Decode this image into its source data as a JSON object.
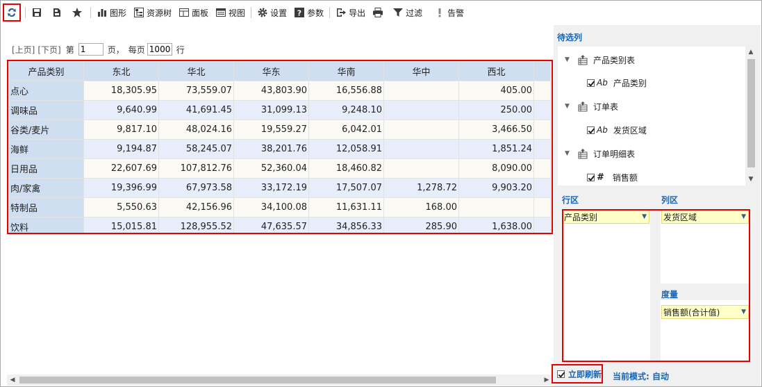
{
  "toolbar": {
    "refresh_title": "刷新",
    "items": [
      {
        "id": "save",
        "icon": "save-icon",
        "label": ""
      },
      {
        "id": "saveas",
        "icon": "save-as-icon",
        "label": ""
      },
      {
        "id": "favorite",
        "icon": "star-icon",
        "label": ""
      },
      {
        "id": "chart",
        "icon": "bar-chart-icon",
        "label": "图形"
      },
      {
        "id": "resource",
        "icon": "resource-tree-icon",
        "label": "资源树"
      },
      {
        "id": "panel",
        "icon": "panel-icon",
        "label": "面板"
      },
      {
        "id": "view",
        "icon": "view-icon",
        "label": "视图"
      },
      {
        "id": "settings",
        "icon": "gear-icon",
        "label": "设置"
      },
      {
        "id": "params",
        "icon": "question-icon",
        "label": "参数"
      },
      {
        "id": "export",
        "icon": "export-icon",
        "label": "导出"
      },
      {
        "id": "print",
        "icon": "printer-icon",
        "label": ""
      },
      {
        "id": "filter",
        "icon": "filter-icon",
        "label": "过滤"
      },
      {
        "id": "alert",
        "icon": "alert-icon",
        "label": "告警"
      }
    ]
  },
  "pager": {
    "prev": "[上页]",
    "next": "[下页]",
    "page_prefix": "第",
    "page_value": "1",
    "page_suffix": "页，",
    "per_page_prefix": "每页",
    "per_page_value": "1000",
    "per_page_suffix": "行"
  },
  "grid": {
    "row_header": "产品类别",
    "columns": [
      "东北",
      "华北",
      "华东",
      "华南",
      "华中",
      "西北"
    ],
    "rows": [
      {
        "label": "点心",
        "values": [
          "18,305.95",
          "73,559.07",
          "43,803.90",
          "16,556.88",
          "",
          "405.00"
        ]
      },
      {
        "label": "调味品",
        "values": [
          "9,640.99",
          "41,691.45",
          "31,099.13",
          "9,248.10",
          "",
          "250.00"
        ]
      },
      {
        "label": "谷类/麦片",
        "values": [
          "9,817.10",
          "48,024.16",
          "19,559.27",
          "6,042.01",
          "",
          "3,466.50"
        ]
      },
      {
        "label": "海鲜",
        "values": [
          "9,194.87",
          "58,245.07",
          "38,201.76",
          "12,058.91",
          "",
          "1,851.24"
        ]
      },
      {
        "label": "日用品",
        "values": [
          "22,607.69",
          "107,812.76",
          "52,360.04",
          "18,460.82",
          "",
          "8,090.00"
        ]
      },
      {
        "label": "肉/家禽",
        "values": [
          "19,396.99",
          "67,973.58",
          "33,172.19",
          "17,507.07",
          "1,278.72",
          "9,903.20"
        ]
      },
      {
        "label": "特制品",
        "values": [
          "5,550.63",
          "42,156.96",
          "34,100.08",
          "11,631.11",
          "168.00",
          ""
        ]
      },
      {
        "label": "饮料",
        "values": [
          "15,015.81",
          "128,955.52",
          "47,635.57",
          "34,856.33",
          "285.90",
          "1,638.00"
        ]
      }
    ]
  },
  "panel": {
    "candidates_title": "待选列",
    "tree": [
      {
        "type": "table",
        "label": "产品类别表"
      },
      {
        "type": "field",
        "kind": "Ab",
        "label": "产品类别"
      },
      {
        "type": "table",
        "label": "订单表"
      },
      {
        "type": "field",
        "kind": "Ab",
        "label": "发货区域"
      },
      {
        "type": "table",
        "label": "订单明细表"
      },
      {
        "type": "field",
        "kind": "#",
        "label": "销售额"
      }
    ],
    "row_zone_title": "行区",
    "col_zone_title": "列区",
    "measure_title": "度量",
    "row_field": "产品类别",
    "col_field": "发货区域",
    "measure_field": "销售额(合计值)",
    "instant_refresh": "立即刷新",
    "mode_text": "当前模式: 自动"
  },
  "colors": {
    "accent": "#1a66b3",
    "highlight": "#e60000",
    "header_bg": "#cfdff1"
  }
}
